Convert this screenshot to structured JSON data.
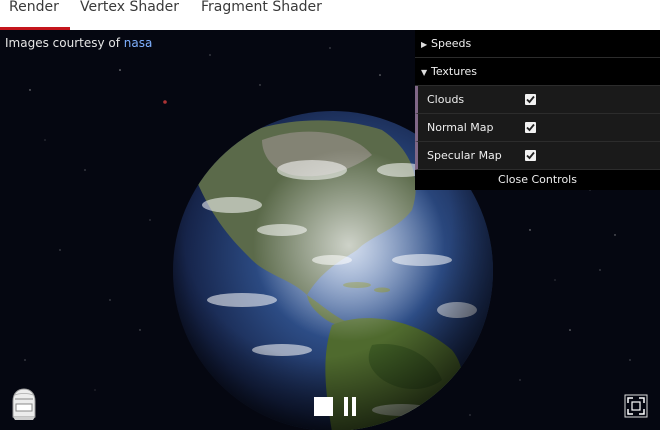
{
  "tabs": [
    {
      "label": "Render"
    },
    {
      "label": "Vertex Shader"
    },
    {
      "label": "Fragment Shader"
    }
  ],
  "credits": {
    "prefix": "Images courtesy of",
    "link": "nasa"
  },
  "gui": {
    "folders": [
      {
        "label": "Speeds",
        "expanded": false
      },
      {
        "label": "Textures",
        "expanded": true
      }
    ],
    "textures": [
      {
        "label": "Clouds",
        "checked": true
      },
      {
        "label": "Normal Map",
        "checked": true
      },
      {
        "label": "Specular Map",
        "checked": true
      }
    ],
    "close_label": "Close Controls"
  },
  "colors": {
    "active_tab_underline": "#c4161c",
    "panel_accent": "#806787",
    "link": "#7fb0ff"
  },
  "icons": {
    "logo": "helmet-logo-icon",
    "stop": "stop-icon",
    "pause": "pause-icon",
    "fullscreen": "fullscreen-icon"
  }
}
